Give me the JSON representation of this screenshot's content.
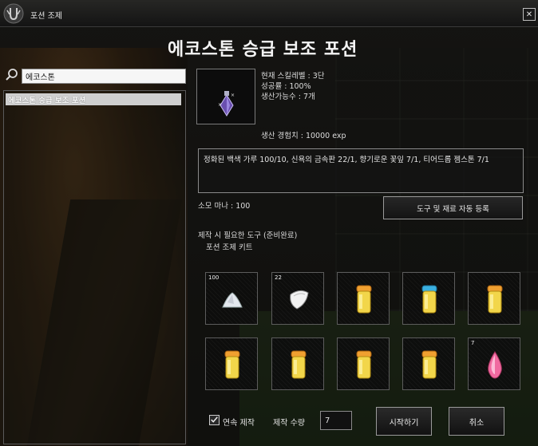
{
  "window": {
    "title": "포션 조제",
    "close_label": "✕"
  },
  "page_title": "에코스톤 승급 보조 포션",
  "search": {
    "value": "에코스톤"
  },
  "recipe_list": [
    {
      "label": "에코스톤 승급 보조 포션",
      "selected": true
    }
  ],
  "info": {
    "skill_level": "현재 스킬레벨 : 3단",
    "success_rate": "성공률 : 100%",
    "craftable_count": "생산가능수 : 7개",
    "production_exp": "생산 경험치 : 10000 exp"
  },
  "ingredients_text": "정화된 백색 가루 100/10, 신욕의 금속판 22/1, 향기로운 꽃잎 7/1, 티어드롭 젬스톤 7/1",
  "mana_cost": "소모 마나 : 100",
  "auto_register_label": "도구 및 재료 자동 등록",
  "tools": {
    "title": "제작 시 필요한 도구 (준비완료)",
    "item": "포션 조제 키트"
  },
  "slots": [
    {
      "icon": "white-powder-icon",
      "qty": "100"
    },
    {
      "icon": "metal-plate-icon",
      "qty": "22"
    },
    {
      "icon": "potion-bottle-orange-icon",
      "qty": ""
    },
    {
      "icon": "potion-bottle-blue-icon",
      "qty": ""
    },
    {
      "icon": "potion-bottle-orange-icon",
      "qty": ""
    },
    {
      "icon": "potion-bottle-orange-icon",
      "qty": ""
    },
    {
      "icon": "potion-bottle-orange-icon",
      "qty": ""
    },
    {
      "icon": "potion-bottle-orange-icon",
      "qty": ""
    },
    {
      "icon": "potion-bottle-orange-icon",
      "qty": ""
    },
    {
      "icon": "teardrop-gem-icon",
      "qty": "7"
    }
  ],
  "continuous_label": "연속 제작",
  "continuous_checked": true,
  "quantity_label": "제작 수량",
  "quantity_value": "7",
  "start_label": "시작하기",
  "cancel_label": "취소",
  "colors": {
    "list_highlight": "#cfcfcf",
    "potion_cap_orange": "#f0a030",
    "potion_cap_blue": "#3ab0e0",
    "potion_liquid": "#f2d64a"
  }
}
